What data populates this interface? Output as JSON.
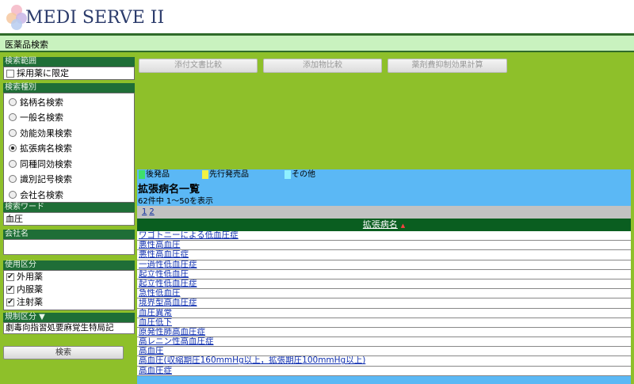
{
  "app": {
    "logo_text": "MEDI SERVE II",
    "section_title": "医薬品検索"
  },
  "toolbar": {
    "compare_package_insert": "添付文書比較",
    "compare_additives": "添加物比較",
    "drug_cost_calc": "薬剤費抑制効果計算"
  },
  "left": {
    "scope_label": "検索範囲",
    "scope_option": "採用薬に限定",
    "type_label": "検索種別",
    "type_options": [
      "銘柄名検索",
      "一般名検索",
      "効能効果検索",
      "拡張病名検索",
      "同種同効検索",
      "識別記号検索",
      "会社名検索"
    ],
    "type_selected": "拡張病名検索",
    "keyword_label": "検索ワード",
    "keyword_value": "血圧",
    "company_label": "会社名",
    "company_value": "",
    "usage_label": "使用区分",
    "usage_options": [
      "外用薬",
      "内服薬",
      "注射薬"
    ],
    "restriction_label": "規制区分 ▼",
    "restriction_value": "劇毒向指習処要麻覚生特局記",
    "search_button": "検索"
  },
  "results": {
    "legend": [
      {
        "label": "後発品",
        "color": "#3fe06a"
      },
      {
        "label": "先行発売品",
        "color": "#f2f244"
      },
      {
        "label": "その他",
        "color": "#8ff0ff"
      }
    ],
    "title": "拡張病名一覧",
    "count_text": "62件中 1～50を表示",
    "pages": [
      "1",
      "2"
    ],
    "column_header": "拡張病名",
    "sort_indicator": "▲",
    "rows": [
      "ワゴトニーによる低血圧症",
      "悪性高血圧",
      "悪性高血圧症",
      "一過性低血圧症",
      "起立性低血圧",
      "起立性低血圧症",
      "急性低血圧",
      "境界型高血圧症",
      "血圧異常",
      "血圧低下",
      "原発性肺高血圧症",
      "高レニン性高血圧症",
      "高血圧",
      "高血圧(収縮期圧160mmHg以上，拡張期圧100mmHg以上)",
      "高血圧症"
    ]
  }
}
